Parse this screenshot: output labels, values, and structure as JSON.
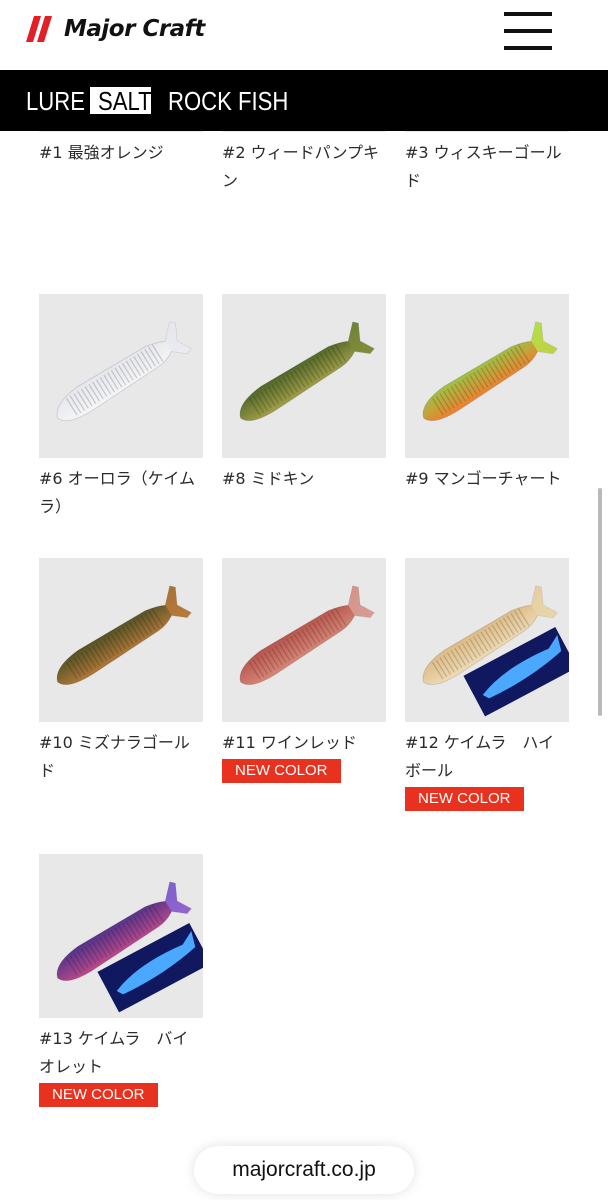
{
  "header": {
    "logo_text": "Major Craft",
    "menu_icon": "hamburger-icon"
  },
  "subnav": {
    "items": [
      "LURE",
      "SALT",
      "ROCK FISH"
    ],
    "active": "SALT"
  },
  "products": [
    {
      "label": "#1 最強オレンジ",
      "badge": "",
      "color": "#e8784a"
    },
    {
      "label": "#2 ウィードパンプキン",
      "badge": "",
      "color": "#5a4a22"
    },
    {
      "label": "#3 ウィスキーゴールド",
      "badge": "",
      "color": "#a98a2a"
    },
    {
      "label": "#6 オーロラ（ケイムラ）",
      "badge": "",
      "color": "#eceef2"
    },
    {
      "label": "#8 ミドキン",
      "badge": "",
      "color": "#4e6a2a"
    },
    {
      "label": "#9 マンゴーチャート",
      "badge": "",
      "color": "#f57a2e"
    },
    {
      "label": "#10 ミズナラゴールド",
      "badge": "",
      "color": "#5a5a2e"
    },
    {
      "label": "#11 ワインレッド",
      "badge": "NEW COLOR",
      "color": "#b8564e"
    },
    {
      "label": "#12 ケイムラ　ハイボール",
      "badge": "NEW COLOR",
      "color": "#e6c78e"
    },
    {
      "label": "#13 ケイムラ　バイオレット",
      "badge": "NEW COLOR",
      "color": "#3b2f8a"
    }
  ],
  "footer": {
    "url": "majorcraft.co.jp"
  },
  "colors": {
    "header_bg": "#000000",
    "badge_bg": "#e8311e",
    "thumb_bg": "#e8e8e8"
  }
}
